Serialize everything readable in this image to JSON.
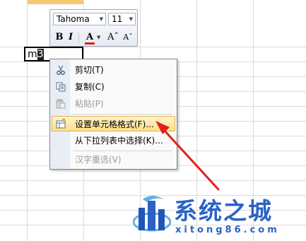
{
  "cell": {
    "text_before": "m",
    "text_selected": "3"
  },
  "mini_toolbar": {
    "font_name": "Tahoma",
    "font_size": "11",
    "bold": "B",
    "italic": "I",
    "font_color": "A",
    "grow": "Aˆ",
    "shrink": "Aˇ"
  },
  "context_menu": {
    "items": [
      {
        "label": "剪切(T)",
        "icon": "scissors-icon",
        "enabled": true
      },
      {
        "label": "复制(C)",
        "icon": "copy-icon",
        "enabled": true
      },
      {
        "label": "粘贴(P)",
        "icon": "paste-icon",
        "enabled": false
      },
      {
        "label": "设置单元格格式(F)...",
        "icon": "format-cells-icon",
        "enabled": true,
        "highlighted": true
      },
      {
        "label": "从下拉列表中选择(K)...",
        "icon": "",
        "enabled": true
      },
      {
        "label": "汉字重选(V)",
        "icon": "",
        "enabled": false
      }
    ]
  },
  "watermark": {
    "brand": "系统之城",
    "url": "xitong86.com"
  },
  "colors": {
    "accent": "#2a62c6",
    "highlight": "#fddf8e",
    "arrow": "#e02020"
  }
}
